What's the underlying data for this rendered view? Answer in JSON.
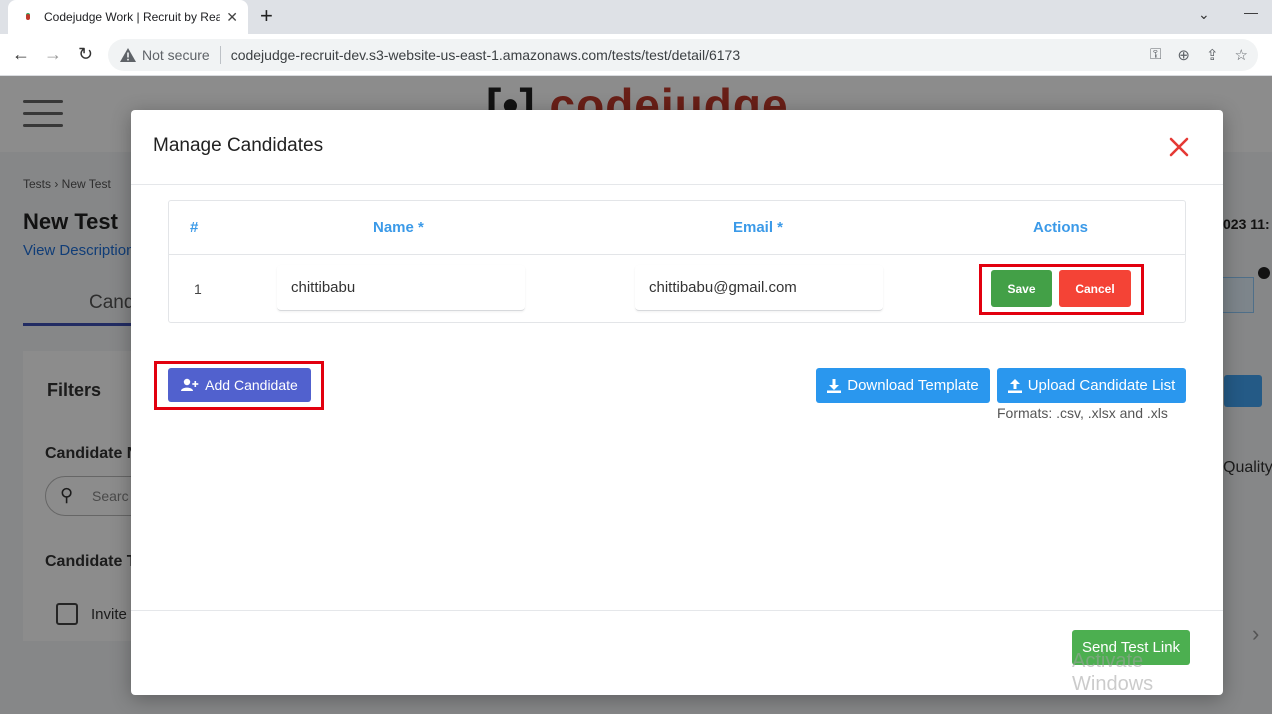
{
  "browser": {
    "tab_title": "Codejudge Work | Recruit by Real",
    "tab_close": "✕",
    "new_tab": "+",
    "not_secure": "Not secure",
    "url": "codejudge-recruit-dev.s3-website-us-east-1.amazonaws.com/tests/test/detail/6173",
    "back": "←",
    "forward": "→",
    "reload": "↻",
    "minimize": "—",
    "dropdown": "⌄"
  },
  "background": {
    "logo_text": "codejudge",
    "breadcrumb": "Tests  ›  New Test",
    "page_title": "New Test",
    "view_description": "View Description",
    "tab_label": "Cand",
    "filters_label": "Filters",
    "candidate_name_label": "Candidate N",
    "search_placeholder": "Searc",
    "candidate_type_label": "Candidate T",
    "invite_label": "Invite",
    "date_fragment": "023 11:",
    "quality_label": "Quality"
  },
  "modal": {
    "title": "Manage Candidates",
    "table": {
      "headers": [
        "#",
        "Name *",
        "Email *",
        "Actions"
      ],
      "rows": [
        {
          "num": "1",
          "name": "chittibabu",
          "email": "chittibabu@gmail.com"
        }
      ]
    },
    "save_label": "Save",
    "cancel_label": "Cancel",
    "add_candidate_label": "Add Candidate",
    "download_template_label": "Download Template",
    "upload_list_label": "Upload Candidate List",
    "formats_text": "Formats: .csv, .xlsx and .xls",
    "send_test_link_label": "Send Test Link",
    "watermark": "Activate Windows"
  },
  "colors": {
    "highlight": "#e2000f",
    "header_blue": "#3b9ae8",
    "save_green": "#43a047",
    "cancel_red": "#f44336",
    "add_indigo": "#5161ce",
    "action_blue": "#2a97ee"
  }
}
